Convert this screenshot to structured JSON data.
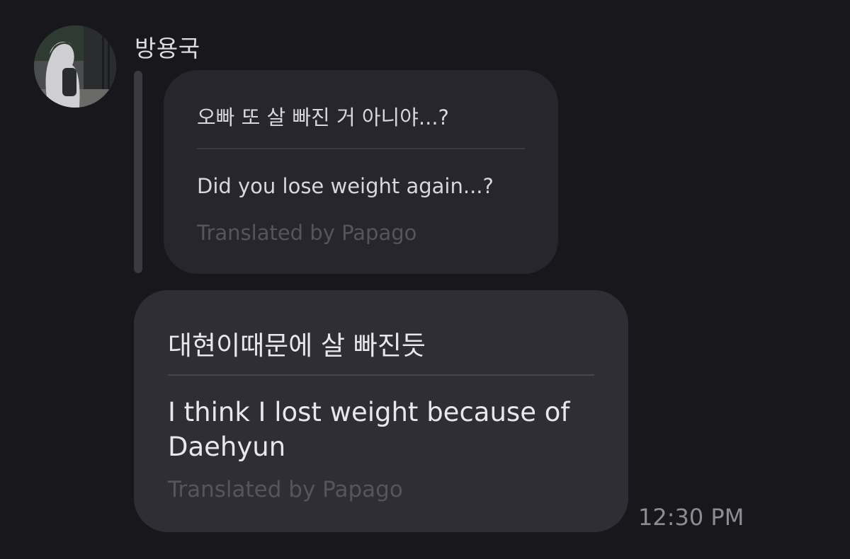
{
  "sender": {
    "name": "방용국",
    "avatar_icon": "profile-photo"
  },
  "quoted_message": {
    "original_text": "오빠 또 살 빠진 거 아니야...?",
    "translated_text": "Did you lose weight again...?",
    "translation_credit": "Translated by Papago"
  },
  "message": {
    "original_text": "대현이때문에 살 빠진듯",
    "translated_text": "I think I lost weight because of Daehyun",
    "translation_credit": "Translated by Papago",
    "timestamp": "12:30 PM"
  },
  "colors": {
    "background": "#17171c",
    "quoted_bubble": "#26262c",
    "message_bubble": "#2e2e34",
    "muted_text": "#55555c"
  }
}
